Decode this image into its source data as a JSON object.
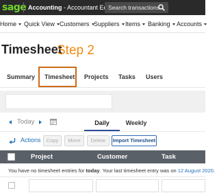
{
  "topbar": {
    "logo": "sage",
    "product_name": "Accounting",
    "product_sep": " - ",
    "edition": "Accountant Edition",
    "search_placeholder": "Search transactions",
    "search_icon": "search-icon"
  },
  "nav": {
    "items": [
      {
        "label": "Home"
      },
      {
        "label": "Quick View"
      },
      {
        "label": "Customers"
      },
      {
        "label": "Suppliers"
      },
      {
        "label": "Items"
      },
      {
        "label": "Banking"
      },
      {
        "label": "Accounts"
      }
    ]
  },
  "page": {
    "title": "Timesheet",
    "annotation": "Step 2",
    "annotation_color": "#f08a12"
  },
  "tabs": [
    {
      "label": "Summary"
    },
    {
      "label": "Timesheet",
      "active": true
    },
    {
      "label": "Projects"
    },
    {
      "label": "Tasks"
    },
    {
      "label": "Users"
    }
  ],
  "datenav": {
    "today_label": "Today",
    "prev_icon": "chevron-left-icon",
    "next_icon": "chevron-right-icon",
    "calendar_icon": "calendar-icon"
  },
  "views": {
    "daily": "Daily",
    "weekly": "Weekly",
    "selected": "Daily"
  },
  "actions": {
    "label": "Actions",
    "icon": "actions-arrow-icon",
    "copy": "Copy",
    "move": "Move",
    "delete": "Delete",
    "import": "Import Timesheet"
  },
  "table": {
    "columns": [
      "Project",
      "Customer",
      "Task"
    ],
    "info_prefix": "You have no timesheet entries for ",
    "info_bold": "today",
    "info_middle": ". Your last timesheet entry was on ",
    "info_date": "12 August 2020",
    "info_suffix": "."
  },
  "colors": {
    "brand_green": "#6fd52a",
    "accent_blue": "#1f6fb7",
    "header_dark": "#2a2a2a",
    "table_header": "#5a6068",
    "highlight_box": "#cc6a16"
  }
}
